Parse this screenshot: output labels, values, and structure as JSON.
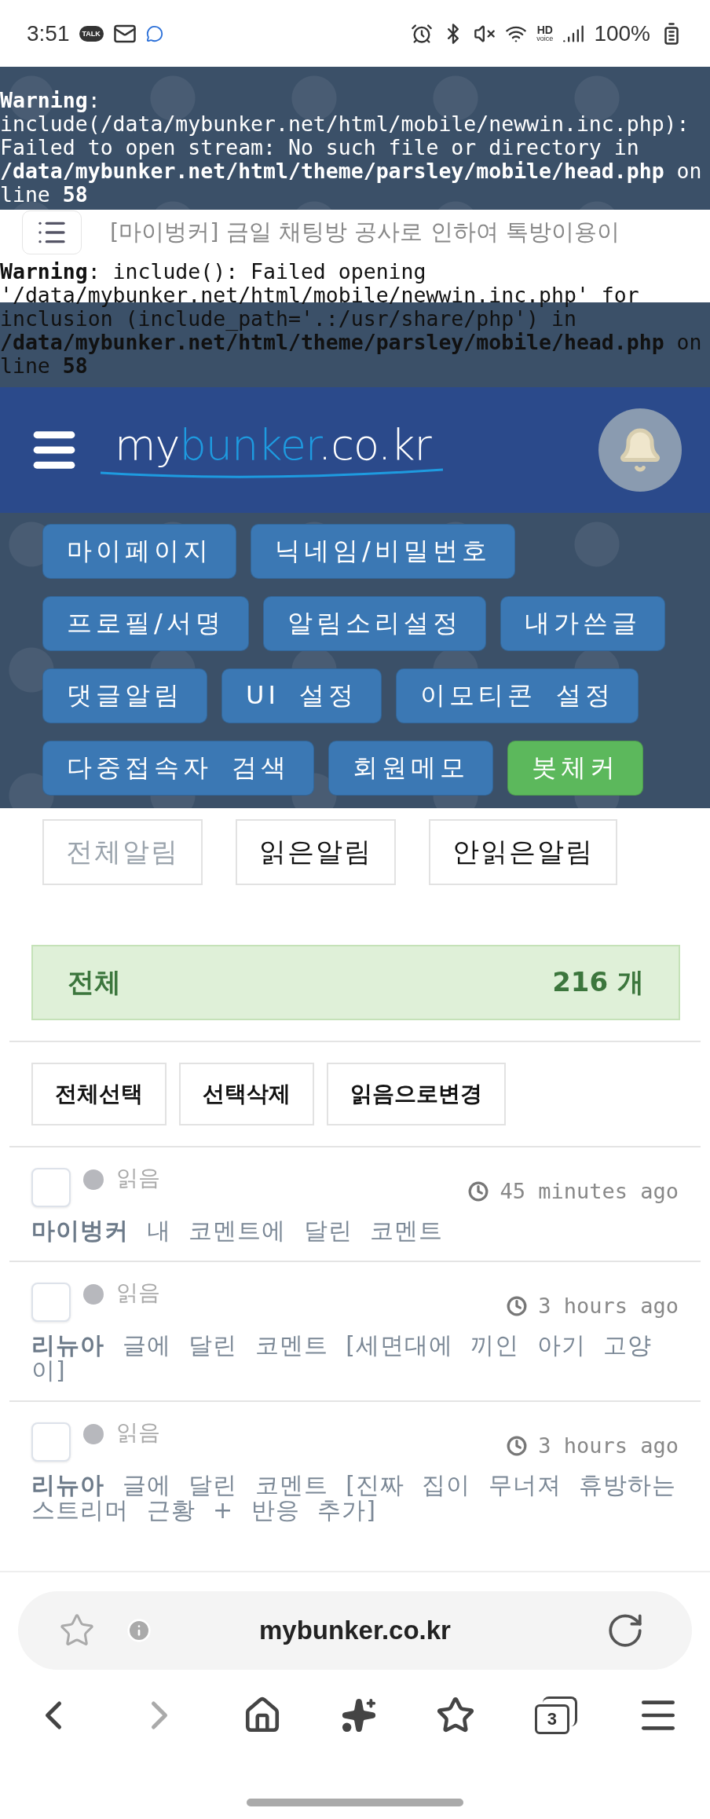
{
  "status_bar": {
    "time": "3:51",
    "talk_badge": "TALK",
    "hd_label": "HD",
    "voice_label": "voice",
    "battery": "100%"
  },
  "warnings": [
    "**Warning**:\ninclude(/data/mybunker.net/html/mobile/newwin.inc.php):\nFailed to open stream: No such file or directory in\n**/data/mybunker.net/html/theme/parsley/mobile/head.php** on\nline **58**",
    "**Warning**: include(): Failed opening\n'/data/mybunker.net/html/mobile/newwin.inc.php' for\ninclusion (include_path='.:/usr/share/php') in\n**/data/mybunker.net/html/theme/parsley/mobile/head.php** on\nline **58**"
  ],
  "notice": "[마이벙커] 금일 채팅방 공사로 인하여 톡방이용이",
  "header": {
    "logo_parts": [
      {
        "text": "my",
        "color": "#ffffff"
      },
      {
        "text": "bunker",
        "color": "#1e9be0"
      },
      {
        "text": ".co.kr",
        "color": "#ffffff"
      }
    ]
  },
  "menu_buttons": [
    {
      "label": "마이페이지",
      "color": "#3b78b4"
    },
    {
      "label": "닉네임/비밀번호",
      "color": "#3b78b4"
    },
    {
      "label": "프로필/서명",
      "color": "#3b78b4"
    },
    {
      "label": "알림소리설정",
      "color": "#3b78b4"
    },
    {
      "label": "내가쓴글",
      "color": "#3b78b4"
    },
    {
      "label": "댓글알림",
      "color": "#3b78b4"
    },
    {
      "label": "UI 설정",
      "color": "#3b78b4"
    },
    {
      "label": "이모티콘 설정",
      "color": "#3b78b4"
    },
    {
      "label": "다중접속자 검색",
      "color": "#3b78b4"
    },
    {
      "label": "회원메모",
      "color": "#3b78b4"
    },
    {
      "label": "봇체커",
      "color": "#5cb85c"
    }
  ],
  "filter_tabs": [
    {
      "label": "전체알림",
      "selected": true
    },
    {
      "label": "읽은알림",
      "selected": false
    },
    {
      "label": "안읽은알림",
      "selected": false
    }
  ],
  "summary": {
    "label": "전체",
    "count": "216 개"
  },
  "actions": [
    "전체선택",
    "선택삭제",
    "읽음으로변경"
  ],
  "notifications": [
    {
      "checked": false,
      "read": true,
      "status": "읽음",
      "time": "45 minutes ago",
      "text": "**마이벙커** 내 코멘트에 달린 코멘트"
    },
    {
      "checked": false,
      "read": true,
      "status": "읽음",
      "time": "3 hours ago",
      "text": "**리뉴아** 글에 달린 코멘트 [세면대에 끼인 아기 고양이]"
    },
    {
      "checked": false,
      "read": true,
      "status": "읽음",
      "time": "3 hours ago",
      "text": "**리뉴아** 글에 달린 코멘트 [진짜 집이 무너져 휴방하는 스트리머 근황 + 반응 추가]"
    }
  ],
  "browser": {
    "url": "mybunker.co.kr",
    "tab_count": "3"
  }
}
